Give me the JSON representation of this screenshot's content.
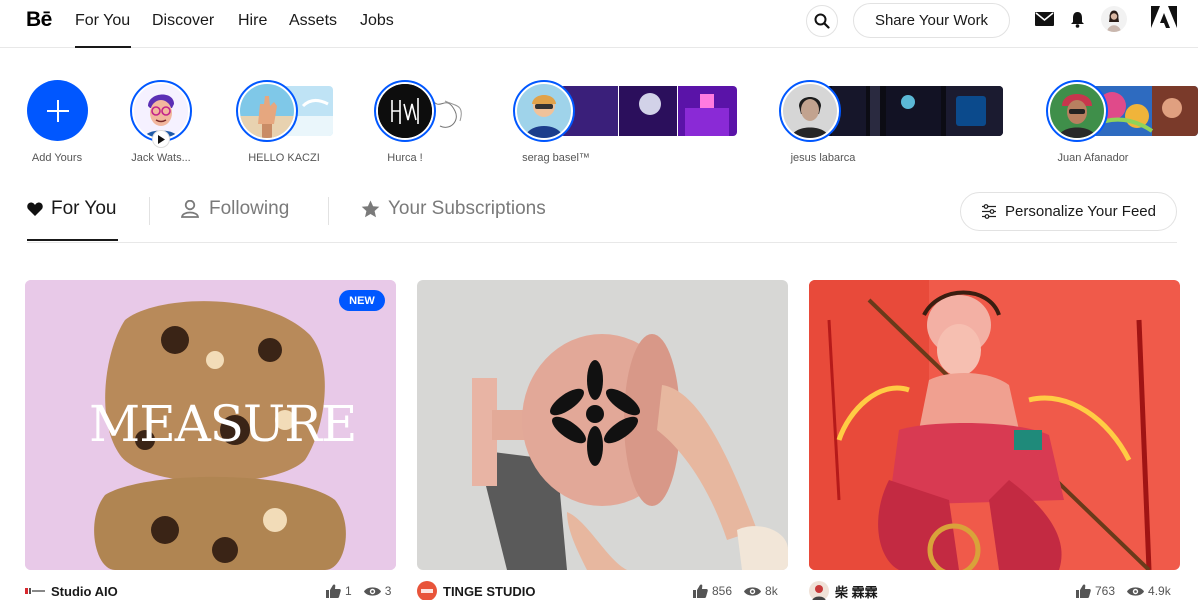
{
  "nav": {
    "logo": "Bē",
    "links": [
      "For You",
      "Discover",
      "Hire",
      "Assets",
      "Jobs"
    ],
    "share_label": "Share Your Work",
    "icons": [
      "search-icon",
      "mail-icon",
      "bell-icon",
      "avatar",
      "adobe-logo"
    ]
  },
  "stories": [
    {
      "label": "Add Yours"
    },
    {
      "label": "Jack Wats..."
    },
    {
      "label": "HELLO KACZI"
    },
    {
      "label": "Hurca !"
    },
    {
      "label": "serag basel™"
    },
    {
      "label": "jesus labarca"
    },
    {
      "label": "Juan Afanador"
    }
  ],
  "tabs": {
    "for_you": "For You",
    "following": "Following",
    "subscriptions": "Your Subscriptions",
    "personalize": "Personalize Your Feed"
  },
  "cards": [
    {
      "owner": "Studio AIO",
      "likes": "1",
      "views": "3",
      "badge": "NEW",
      "artwork_text": "MEASURE"
    },
    {
      "owner": "TINGE STUDIO",
      "likes": "856",
      "views": "8k"
    },
    {
      "owner": "柴 霖霖",
      "likes": "763",
      "views": "4.9k"
    }
  ],
  "colors": {
    "accent": "#0057ff",
    "text": "#191919",
    "muted": "#7a7a7a"
  }
}
